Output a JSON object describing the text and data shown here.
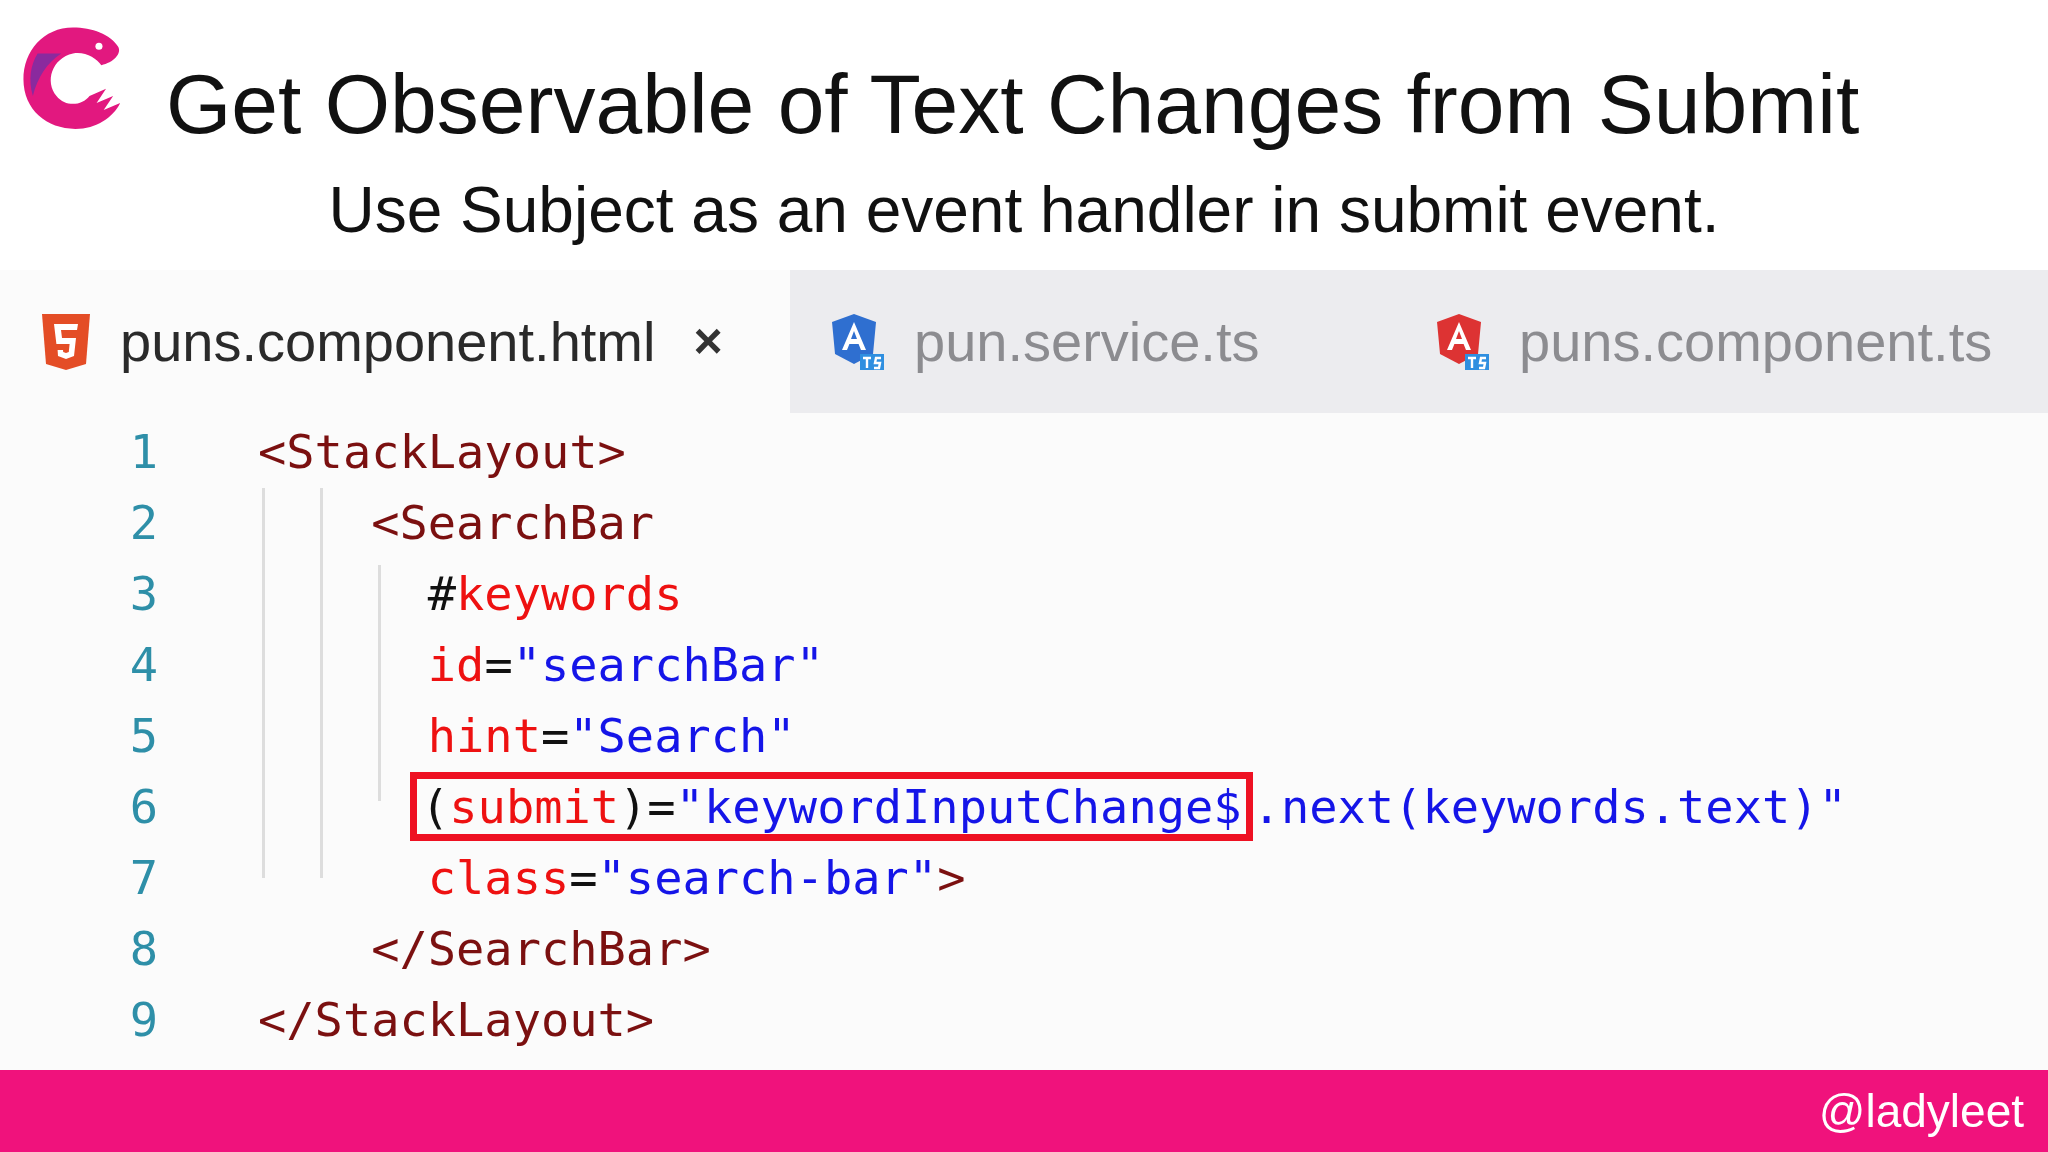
{
  "slide": {
    "title": "Get Observable of Text Changes from Submit",
    "subtitle": "Use Subject as an event handler in submit event."
  },
  "tabs": [
    {
      "label": "puns.component.html",
      "kind": "html",
      "selected": true,
      "close": "×"
    },
    {
      "label": "pun.service.ts",
      "kind": "service",
      "selected": false
    },
    {
      "label": "puns.component.ts",
      "kind": "component",
      "selected": false
    }
  ],
  "code": [
    {
      "number": "1",
      "tokens": [
        {
          "kind": "tag",
          "text": "<StackLayout>"
        }
      ]
    },
    {
      "number": "2",
      "tokens": [
        {
          "kind": "tag",
          "text": "    <SearchBar"
        }
      ]
    },
    {
      "number": "3",
      "tokens": [
        {
          "kind": "punct",
          "text": "      #"
        },
        {
          "kind": "attr",
          "text": "keywords"
        }
      ]
    },
    {
      "number": "4",
      "tokens": [
        {
          "kind": "attr",
          "text": "      id"
        },
        {
          "kind": "punct",
          "text": "="
        },
        {
          "kind": "string",
          "text": "\"searchBar\""
        }
      ]
    },
    {
      "number": "5",
      "tokens": [
        {
          "kind": "attr",
          "text": "      hint"
        },
        {
          "kind": "punct",
          "text": "="
        },
        {
          "kind": "string",
          "text": "\"Search\""
        }
      ]
    },
    {
      "number": "6",
      "tokens": [
        {
          "kind": "punct",
          "text": "(",
          "highlighted": true
        },
        {
          "kind": "attr",
          "text": "submit",
          "highlighted": true
        },
        {
          "kind": "punct",
          "text": ")=",
          "highlighted": true
        },
        {
          "kind": "string",
          "text": "\"keywordInputChange$",
          "highlighted": true
        },
        {
          "kind": "string",
          "text": ".next(keywords.text)\"",
          "highlighted": false
        }
      ]
    },
    {
      "number": "7",
      "tokens": [
        {
          "kind": "attr",
          "text": "      class"
        },
        {
          "kind": "punct",
          "text": "="
        },
        {
          "kind": "string",
          "text": "\"search-bar\""
        },
        {
          "kind": "tag",
          "text": ">"
        }
      ]
    },
    {
      "number": "8",
      "tokens": [
        {
          "kind": "tag",
          "text": "    </SearchBar>"
        }
      ]
    },
    {
      "number": "9",
      "tokens": [
        {
          "kind": "tag",
          "text": "</StackLayout>"
        }
      ]
    }
  ],
  "footer": {
    "handle": "@ladyleet"
  }
}
